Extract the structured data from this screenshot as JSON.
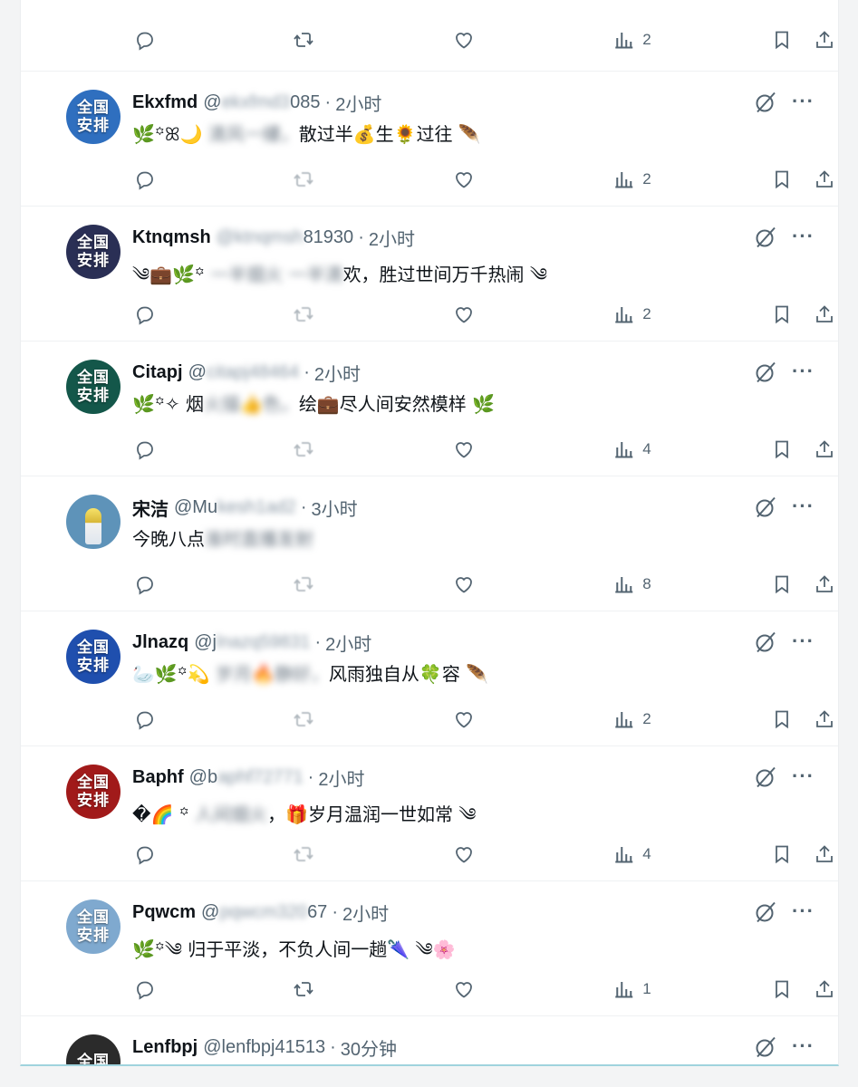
{
  "top_actions": {
    "views": "2"
  },
  "tweets": [
    {
      "avatar_line1": "全国",
      "avatar_line2": "安排",
      "avatar_bg": "#2f6fbf",
      "name": "Ekxfmd",
      "handle_prefix": "@",
      "handle_hidden": "ekxfmd3",
      "handle_suffix": "085",
      "dot": "·",
      "time": "2小时",
      "text_a": "🌿꙳ꕤ🌙 ",
      "text_hidden": "清风一縷，",
      "text_b": "散过半💰生🌻过往 🪶",
      "views": "2",
      "retweet_faded": true
    },
    {
      "avatar_line1": "全国",
      "avatar_line2": "安排",
      "avatar_bg": "#2a2f55",
      "name": "Ktnqmsh",
      "handle_prefix": "",
      "handle_hidden": "@ktnqmsh",
      "handle_suffix": "81930",
      "dot": "·",
      "time": "2小时",
      "text_a": "༄💼🌿꙳ ",
      "text_hidden": "一半烟火 一半清",
      "text_b": "欢，胜过世间万千热闹 ༄",
      "views": "2",
      "retweet_faded": true
    },
    {
      "avatar_line1": "全国",
      "avatar_line2": "安排",
      "avatar_bg": "#14574a",
      "name": "Citapj",
      "handle_prefix": "@",
      "handle_hidden": "citapj48464",
      "handle_suffix": "",
      "dot": "·",
      "time": "2小时",
      "text_a": "🌿꙳✧ 烟",
      "text_hidden": "火描👍色，",
      "text_b": "绘💼尽人间安然模样 🌿",
      "views": "4",
      "retweet_faded": true
    },
    {
      "avatar_line1": "",
      "avatar_line2": "",
      "avatar_bg": "#5e93b9",
      "avatar_photo": true,
      "name": "宋洁",
      "handle_prefix": "@Mu",
      "handle_hidden": "kesh1ad2",
      "handle_suffix": "",
      "dot": "·",
      "time": "3小时",
      "text_a": "今晚八点",
      "text_hidden": "准时直播发射",
      "text_b": "",
      "views": "8",
      "retweet_faded": true
    },
    {
      "avatar_line1": "全国",
      "avatar_line2": "安排",
      "avatar_bg": "#1f4fae",
      "name": "Jlnazq",
      "handle_prefix": "@j",
      "handle_hidden": "lnazq59831",
      "handle_suffix": "",
      "dot": "·",
      "time": "2小时",
      "text_a": "🦢🌿꙳💫 ",
      "text_hidden": "岁月🔥静好，",
      "text_b": "风雨独自从🍀容 🪶",
      "views": "2",
      "retweet_faded": true
    },
    {
      "avatar_line1": "全国",
      "avatar_line2": "安排",
      "avatar_bg": "#a11a1a",
      "name": "Baphf",
      "handle_prefix": "@b",
      "handle_hidden": "aphf72771",
      "handle_suffix": "",
      "dot": "·",
      "time": "2小时",
      "text_a": "�🌈    ꙳ ",
      "text_hidden": "人间烟火",
      "text_b": "，🎁岁月温润一世如常 ༄",
      "views": "4",
      "retweet_faded": true
    },
    {
      "avatar_line1": "全国",
      "avatar_line2": "安排",
      "avatar_bg": "#7fa9cf",
      "name": "Pqwcm",
      "handle_prefix": "@",
      "handle_hidden": "pqwcm320",
      "handle_suffix": "67",
      "dot": "·",
      "time": "2小时",
      "text_a": "🌿꙳༄ 归于平淡，不负人间一趟🌂 ༄🌸",
      "text_hidden": "",
      "text_b": "",
      "views": "1",
      "retweet_faded": false
    },
    {
      "avatar_line1": "全国",
      "avatar_line2": "",
      "avatar_bg": "#2b2b2b",
      "name": "Lenfbpj",
      "handle_prefix": "@lenfbpj41513",
      "handle_hidden": "",
      "handle_suffix": "",
      "dot": "·",
      "time": "30分钟",
      "text_a": "",
      "text_hidden": "",
      "text_b": "",
      "views": "",
      "retweet_faded": false
    }
  ],
  "colors": {
    "text": "#0f1419",
    "muted": "#536471",
    "divider": "#eff1f3"
  },
  "icons": [
    "reply-icon",
    "retweet-icon",
    "like-icon",
    "views-icon",
    "bookmark-icon",
    "share-icon",
    "grok-icon",
    "more-icon"
  ]
}
